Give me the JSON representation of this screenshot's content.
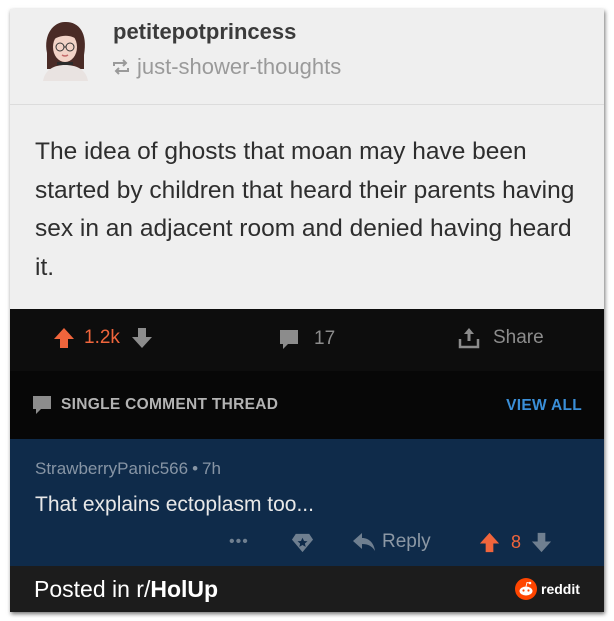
{
  "post": {
    "username": "petitepotprincess",
    "reblog_source": "just-shower-thoughts",
    "text": "The idea of ghosts that moan may have been started by children that heard their parents having sex in an adjacent room and denied having heard it."
  },
  "actions": {
    "upvotes": "1.2k",
    "comments": "17",
    "share_label": "Share"
  },
  "thread": {
    "title": "SINGLE COMMENT THREAD",
    "view_all": "VIEW ALL"
  },
  "comment": {
    "author": "StrawberryPanic566",
    "separator": "•",
    "age": "7h",
    "body": "That explains ectoplasm too...",
    "more": "•••",
    "reply_label": "Reply",
    "votes": "8"
  },
  "footer": {
    "posted_prefix": "Posted in r/",
    "subreddit": "HolUp",
    "brand": "reddit"
  },
  "colors": {
    "upvote": "#f0653c",
    "link_blue": "#3a8fd8",
    "comment_bg": "#0f2b4a"
  }
}
